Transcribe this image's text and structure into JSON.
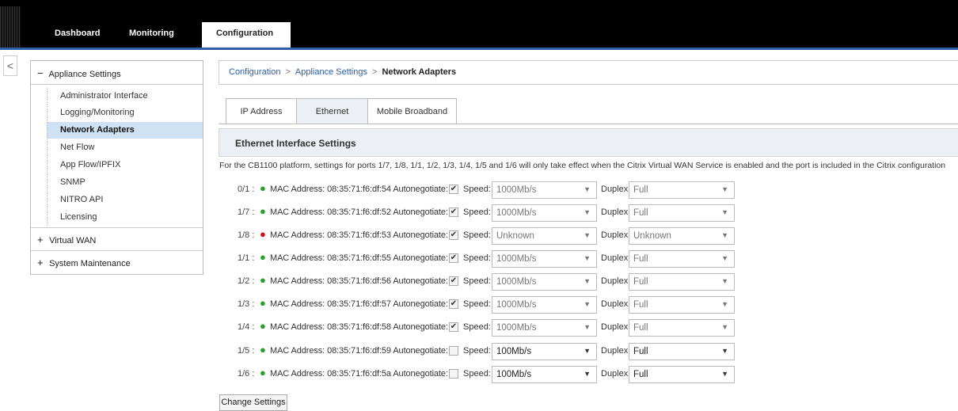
{
  "nav": {
    "tabs": [
      "Dashboard",
      "Monitoring",
      "Configuration"
    ],
    "active": "Configuration"
  },
  "sidebar": {
    "collapse_glyph": "<",
    "groups": [
      {
        "toggle": "−",
        "label": "Appliance Settings",
        "expanded": true
      },
      {
        "toggle": "+",
        "label": "Virtual WAN",
        "expanded": false
      },
      {
        "toggle": "+",
        "label": "System Maintenance",
        "expanded": false
      }
    ],
    "items": [
      "Administrator Interface",
      "Logging/Monitoring",
      "Network Adapters",
      "Net Flow",
      "App Flow/IPFIX",
      "SNMP",
      "NITRO API",
      "Licensing"
    ],
    "active_item": "Network Adapters"
  },
  "breadcrumb": {
    "items": [
      "Configuration",
      "Appliance Settings",
      "Network Adapters"
    ],
    "separator": ">"
  },
  "tabs": {
    "items": [
      "IP Address",
      "Ethernet",
      "Mobile Broadband"
    ],
    "active": "Ethernet"
  },
  "panel": {
    "title": "Ethernet Interface Settings",
    "note": "For the CB1100 platform, settings for ports 1/7, 1/8, 1/1, 1/2, 1/3, 1/4, 1/5 and 1/6 will only take effect when the Citrix Virtual WAN Service is enabled and the port is included in the Citrix configuration"
  },
  "labels": {
    "mac": "MAC Address:",
    "autoneg": "Autonegotiate:",
    "speed": "Speed:",
    "duplex": "Duplex:"
  },
  "ports": [
    {
      "port": "0/1 :",
      "status": "green",
      "mac": "08:35:71:f6:df:54",
      "autoneg": true,
      "speed": "1000Mb/s",
      "duplex": "Full",
      "enabled": false
    },
    {
      "port": "1/7 :",
      "status": "green",
      "mac": "08:35:71:f6:df:52",
      "autoneg": true,
      "speed": "1000Mb/s",
      "duplex": "Full",
      "enabled": false
    },
    {
      "port": "1/8 :",
      "status": "red",
      "mac": "08:35:71:f6:df:53",
      "autoneg": true,
      "speed": "Unknown",
      "duplex": "Unknown",
      "enabled": false
    },
    {
      "port": "1/1 :",
      "status": "green",
      "mac": "08:35:71:f6:df:55",
      "autoneg": true,
      "speed": "1000Mb/s",
      "duplex": "Full",
      "enabled": false
    },
    {
      "port": "1/2 :",
      "status": "green",
      "mac": "08:35:71:f6:df:56",
      "autoneg": true,
      "speed": "1000Mb/s",
      "duplex": "Full",
      "enabled": false
    },
    {
      "port": "1/3 :",
      "status": "green",
      "mac": "08:35:71:f6:df:57",
      "autoneg": true,
      "speed": "1000Mb/s",
      "duplex": "Full",
      "enabled": false
    },
    {
      "port": "1/4 :",
      "status": "green",
      "mac": "08:35:71:f6:df:58",
      "autoneg": true,
      "speed": "1000Mb/s",
      "duplex": "Full",
      "enabled": false
    },
    {
      "port": "1/5 :",
      "status": "green",
      "mac": "08:35:71:f6:df:59",
      "autoneg": false,
      "speed": "100Mb/s",
      "duplex": "Full",
      "enabled": true
    },
    {
      "port": "1/6 :",
      "status": "green",
      "mac": "08:35:71:f6:df:5a",
      "autoneg": false,
      "speed": "100Mb/s",
      "duplex": "Full",
      "enabled": true
    }
  ],
  "actions": {
    "change_settings": "Change Settings"
  },
  "colors": {
    "brand_blue": "#2a5ea8",
    "status_up": "#2aa02a",
    "status_down": "#d01010",
    "active_item": "#cfe2f3"
  }
}
